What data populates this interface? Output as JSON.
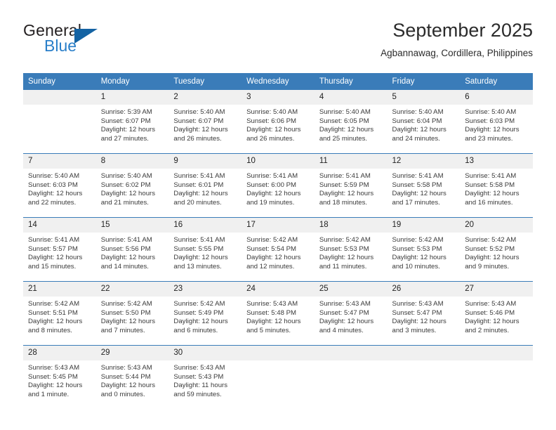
{
  "logo": {
    "word_one": "General",
    "word_two": "Blue",
    "flag_icon": "triangle-flag-icon"
  },
  "header": {
    "title": "September 2025",
    "subtitle": "Agbannawag, Cordillera, Philippines"
  },
  "colors": {
    "header_blue": "#3a7cb9",
    "logo_blue": "#2a7fc9",
    "logo_flag_blue": "#1463a3",
    "daynum_bg": "#f0f0f0",
    "cell_text": "#3a3a3a"
  },
  "calendar": {
    "weekday_headers": [
      "Sunday",
      "Monday",
      "Tuesday",
      "Wednesday",
      "Thursday",
      "Friday",
      "Saturday"
    ],
    "weeks": [
      [
        {
          "day": "",
          "lines": []
        },
        {
          "day": "1",
          "lines": [
            "Sunrise: 5:39 AM",
            "Sunset: 6:07 PM",
            "Daylight: 12 hours",
            "and 27 minutes."
          ]
        },
        {
          "day": "2",
          "lines": [
            "Sunrise: 5:40 AM",
            "Sunset: 6:07 PM",
            "Daylight: 12 hours",
            "and 26 minutes."
          ]
        },
        {
          "day": "3",
          "lines": [
            "Sunrise: 5:40 AM",
            "Sunset: 6:06 PM",
            "Daylight: 12 hours",
            "and 26 minutes."
          ]
        },
        {
          "day": "4",
          "lines": [
            "Sunrise: 5:40 AM",
            "Sunset: 6:05 PM",
            "Daylight: 12 hours",
            "and 25 minutes."
          ]
        },
        {
          "day": "5",
          "lines": [
            "Sunrise: 5:40 AM",
            "Sunset: 6:04 PM",
            "Daylight: 12 hours",
            "and 24 minutes."
          ]
        },
        {
          "day": "6",
          "lines": [
            "Sunrise: 5:40 AM",
            "Sunset: 6:03 PM",
            "Daylight: 12 hours",
            "and 23 minutes."
          ]
        }
      ],
      [
        {
          "day": "7",
          "lines": [
            "Sunrise: 5:40 AM",
            "Sunset: 6:03 PM",
            "Daylight: 12 hours",
            "and 22 minutes."
          ]
        },
        {
          "day": "8",
          "lines": [
            "Sunrise: 5:40 AM",
            "Sunset: 6:02 PM",
            "Daylight: 12 hours",
            "and 21 minutes."
          ]
        },
        {
          "day": "9",
          "lines": [
            "Sunrise: 5:41 AM",
            "Sunset: 6:01 PM",
            "Daylight: 12 hours",
            "and 20 minutes."
          ]
        },
        {
          "day": "10",
          "lines": [
            "Sunrise: 5:41 AM",
            "Sunset: 6:00 PM",
            "Daylight: 12 hours",
            "and 19 minutes."
          ]
        },
        {
          "day": "11",
          "lines": [
            "Sunrise: 5:41 AM",
            "Sunset: 5:59 PM",
            "Daylight: 12 hours",
            "and 18 minutes."
          ]
        },
        {
          "day": "12",
          "lines": [
            "Sunrise: 5:41 AM",
            "Sunset: 5:58 PM",
            "Daylight: 12 hours",
            "and 17 minutes."
          ]
        },
        {
          "day": "13",
          "lines": [
            "Sunrise: 5:41 AM",
            "Sunset: 5:58 PM",
            "Daylight: 12 hours",
            "and 16 minutes."
          ]
        }
      ],
      [
        {
          "day": "14",
          "lines": [
            "Sunrise: 5:41 AM",
            "Sunset: 5:57 PM",
            "Daylight: 12 hours",
            "and 15 minutes."
          ]
        },
        {
          "day": "15",
          "lines": [
            "Sunrise: 5:41 AM",
            "Sunset: 5:56 PM",
            "Daylight: 12 hours",
            "and 14 minutes."
          ]
        },
        {
          "day": "16",
          "lines": [
            "Sunrise: 5:41 AM",
            "Sunset: 5:55 PM",
            "Daylight: 12 hours",
            "and 13 minutes."
          ]
        },
        {
          "day": "17",
          "lines": [
            "Sunrise: 5:42 AM",
            "Sunset: 5:54 PM",
            "Daylight: 12 hours",
            "and 12 minutes."
          ]
        },
        {
          "day": "18",
          "lines": [
            "Sunrise: 5:42 AM",
            "Sunset: 5:53 PM",
            "Daylight: 12 hours",
            "and 11 minutes."
          ]
        },
        {
          "day": "19",
          "lines": [
            "Sunrise: 5:42 AM",
            "Sunset: 5:53 PM",
            "Daylight: 12 hours",
            "and 10 minutes."
          ]
        },
        {
          "day": "20",
          "lines": [
            "Sunrise: 5:42 AM",
            "Sunset: 5:52 PM",
            "Daylight: 12 hours",
            "and 9 minutes."
          ]
        }
      ],
      [
        {
          "day": "21",
          "lines": [
            "Sunrise: 5:42 AM",
            "Sunset: 5:51 PM",
            "Daylight: 12 hours",
            "and 8 minutes."
          ]
        },
        {
          "day": "22",
          "lines": [
            "Sunrise: 5:42 AM",
            "Sunset: 5:50 PM",
            "Daylight: 12 hours",
            "and 7 minutes."
          ]
        },
        {
          "day": "23",
          "lines": [
            "Sunrise: 5:42 AM",
            "Sunset: 5:49 PM",
            "Daylight: 12 hours",
            "and 6 minutes."
          ]
        },
        {
          "day": "24",
          "lines": [
            "Sunrise: 5:43 AM",
            "Sunset: 5:48 PM",
            "Daylight: 12 hours",
            "and 5 minutes."
          ]
        },
        {
          "day": "25",
          "lines": [
            "Sunrise: 5:43 AM",
            "Sunset: 5:47 PM",
            "Daylight: 12 hours",
            "and 4 minutes."
          ]
        },
        {
          "day": "26",
          "lines": [
            "Sunrise: 5:43 AM",
            "Sunset: 5:47 PM",
            "Daylight: 12 hours",
            "and 3 minutes."
          ]
        },
        {
          "day": "27",
          "lines": [
            "Sunrise: 5:43 AM",
            "Sunset: 5:46 PM",
            "Daylight: 12 hours",
            "and 2 minutes."
          ]
        }
      ],
      [
        {
          "day": "28",
          "lines": [
            "Sunrise: 5:43 AM",
            "Sunset: 5:45 PM",
            "Daylight: 12 hours",
            "and 1 minute."
          ]
        },
        {
          "day": "29",
          "lines": [
            "Sunrise: 5:43 AM",
            "Sunset: 5:44 PM",
            "Daylight: 12 hours",
            "and 0 minutes."
          ]
        },
        {
          "day": "30",
          "lines": [
            "Sunrise: 5:43 AM",
            "Sunset: 5:43 PM",
            "Daylight: 11 hours",
            "and 59 minutes."
          ]
        },
        {
          "day": "",
          "lines": []
        },
        {
          "day": "",
          "lines": []
        },
        {
          "day": "",
          "lines": []
        },
        {
          "day": "",
          "lines": []
        }
      ]
    ]
  }
}
